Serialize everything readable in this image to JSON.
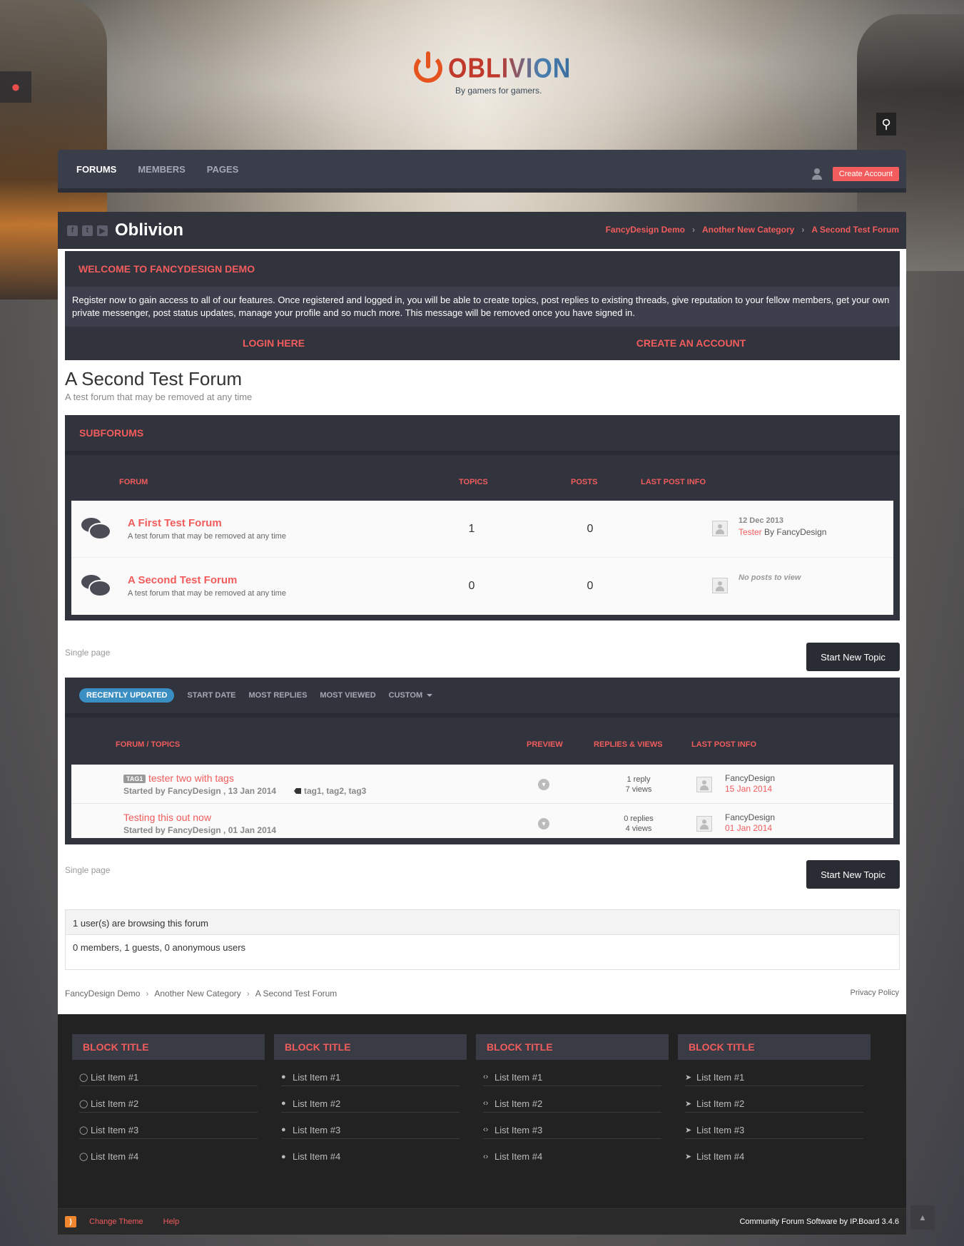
{
  "header": {
    "logo_text": "OBLIVION",
    "tagline": "By gamers for gamers.",
    "drop_icon": "drop-icon",
    "search_icon": "search-icon"
  },
  "nav": {
    "items": [
      "FORUMS",
      "MEMBERS",
      "PAGES"
    ],
    "active": "FORUMS",
    "create_account": "Create Account"
  },
  "titlebar": {
    "site_title": "Oblivion",
    "social": [
      "f",
      "t",
      "▶"
    ],
    "breadcrumbs": [
      "FancyDesign Demo",
      "Another New Category",
      "A Second Test Forum"
    ]
  },
  "welcome": {
    "title": "WELCOME TO FANCYDESIGN DEMO",
    "body": "Register now to gain access to all of our features. Once registered and logged in, you will be able to create topics, post replies to existing threads, give reputation to your fellow members, get your own private messenger, post status updates, manage your profile and so much more. This message will be removed once you have signed in.",
    "login": "LOGIN HERE",
    "create": "CREATE AN ACCOUNT"
  },
  "forum": {
    "title": "A Second Test Forum",
    "description": "A test forum that may be removed at any time"
  },
  "subforums": {
    "title": "SUBFORUMS",
    "columns": [
      "FORUM",
      "TOPICS",
      "POSTS",
      "LAST POST INFO"
    ],
    "rows": [
      {
        "name": "A First Test Forum",
        "desc": "A test forum that may be removed at any time",
        "topics": "1",
        "posts": "0",
        "last_date": "12 Dec 2013",
        "last_topic": "Tester",
        "last_by": "By",
        "last_user": "FancyDesign"
      },
      {
        "name": "A Second Test Forum",
        "desc": "A test forum that may be removed at any time",
        "topics": "0",
        "posts": "0",
        "no_posts": "No posts to view"
      }
    ]
  },
  "pagination": {
    "single_page": "Single page",
    "start_topic": "Start New Topic"
  },
  "topics": {
    "filters": [
      "RECENTLY UPDATED",
      "START DATE",
      "MOST REPLIES",
      "MOST VIEWED",
      "CUSTOM"
    ],
    "columns": [
      "FORUM / TOPICS",
      "PREVIEW",
      "REPLIES & VIEWS",
      "LAST POST INFO"
    ],
    "rows": [
      {
        "tag": "TAG1",
        "title": "tester two with tags",
        "started": "Started by FancyDesign , 13 Jan 2014",
        "tags": "tag1, tag2, tag3",
        "replies": "1 reply",
        "views": "7 views",
        "last_user": "FancyDesign",
        "last_date": "15 Jan 2014"
      },
      {
        "title": "Testing this out now",
        "started": "Started by FancyDesign , 01 Jan 2014",
        "replies": "0 replies",
        "views": "4 views",
        "last_user": "FancyDesign",
        "last_date": "01 Jan 2014"
      }
    ]
  },
  "browsing": {
    "head": "1 user(s) are browsing this forum",
    "body": "0 members, 1 guests, 0 anonymous users"
  },
  "bottom": {
    "breadcrumbs": [
      "FancyDesign Demo",
      "Another New Category",
      "A Second Test Forum"
    ],
    "privacy": "Privacy Policy"
  },
  "footer": {
    "blocks": [
      {
        "title": "BLOCK TITLE",
        "icon": "comment-outline-icon",
        "items": [
          "List Item #1",
          "List Item #2",
          "List Item #3",
          "List Item #4"
        ]
      },
      {
        "title": "BLOCK TITLE",
        "icon": "comment-icon",
        "items": [
          "List Item #1",
          "List Item #2",
          "List Item #3",
          "List Item #4"
        ]
      },
      {
        "title": "BLOCK TITLE",
        "icon": "code-icon",
        "items": [
          "List Item #1",
          "List Item #2",
          "List Item #3",
          "List Item #4"
        ]
      },
      {
        "title": "BLOCK TITLE",
        "icon": "location-arrow-icon",
        "items": [
          "List Item #1",
          "List Item #2",
          "List Item #3",
          "List Item #4"
        ]
      }
    ],
    "links": [
      "Change Theme",
      "Help"
    ],
    "powered": "Community Forum Software by IP.Board 3.4.6"
  },
  "colors": {
    "accent": "#f25c5c",
    "dark": "#31333d",
    "nav": "#3a3d4a",
    "filter_active": "#3b8ec2"
  }
}
